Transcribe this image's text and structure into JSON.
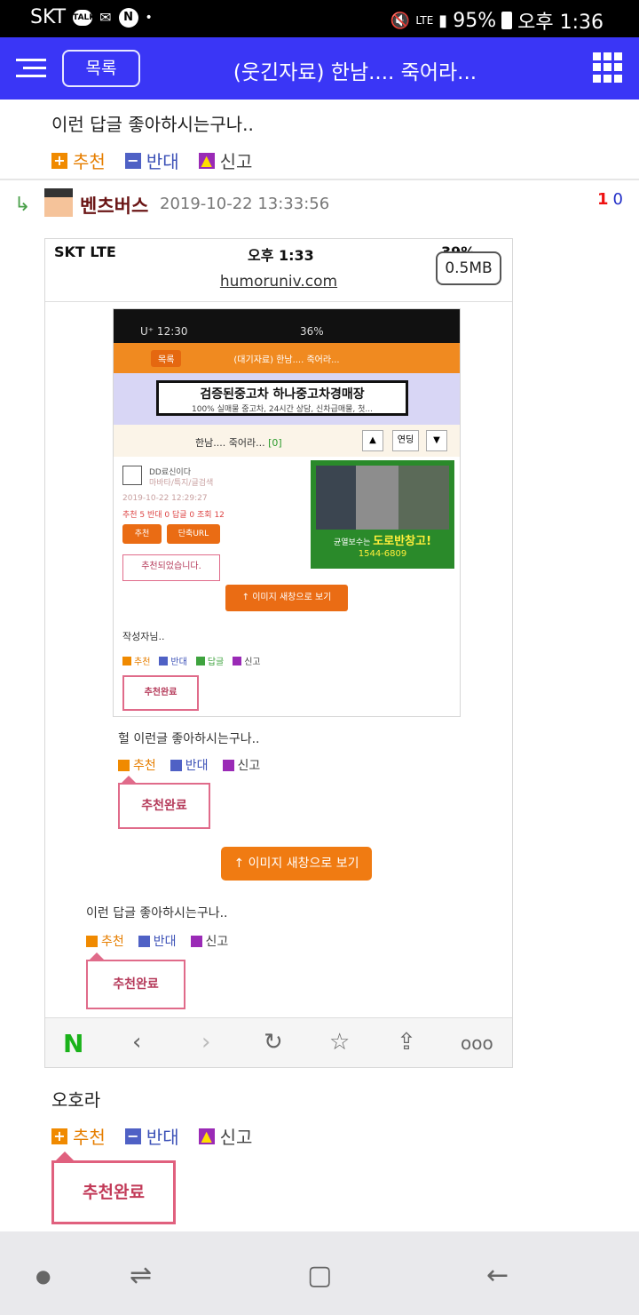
{
  "status_bar": {
    "carrier": "SKT",
    "talk_badge": "TALK",
    "n_badge": "N",
    "dot": "•",
    "lte": "LTE",
    "battery": "95%",
    "time": "오후 1:36"
  },
  "app_bar": {
    "list_button": "목록",
    "title": "(웃긴자료) 한남.... 죽어라..."
  },
  "comment_top": {
    "text": "이런 답글 좋아하시는구나..",
    "recommend": "추천",
    "oppose": "반대",
    "report": "신고"
  },
  "reply": {
    "username": "벤츠버스",
    "timestamp": "2019-10-22 13:33:56",
    "up_count": "1",
    "down_count": "0"
  },
  "screenshot": {
    "status_left": "SKT LTE",
    "status_time": "오후 1:33",
    "status_right": "39%",
    "file_size": "0.5MB",
    "url": "humoruniv.com",
    "inner": {
      "status": "U⁺ 12:30",
      "status_right": "36%",
      "list": "목록",
      "title": "(대기자료) 한남.... 죽어라...",
      "ad_title": "검증된중고차 하나중고차경매장",
      "ad_sub": "100% 실매물 중고차, 24시간 상담, 신차급매물, 첫...",
      "post_title": "한남.... 죽어라...",
      "post_count": "[0]",
      "nav_up": "▲",
      "nav_mid": "연딩",
      "nav_down": "▼",
      "author": "DD료신이다",
      "author_sub": "마바타/특지/글검색",
      "date": "2019-10-22 12:29:27",
      "stats": "추천 5 반대 0 답글 0 조회 12",
      "btn_recommend": "추천",
      "btn_url": "단축URL",
      "recommended_msg": "추천되었습니다.",
      "photo_caption": "균열보수는",
      "photo_brand": "도로반창고!",
      "photo_phone": "1544-6809",
      "view_image": "↑ 이미지 새창으로 보기",
      "comment": "작성자님..",
      "vote_rec": "추천",
      "vote_opp": "반대",
      "vote_reply": "답글",
      "vote_rep": "신고",
      "done": "추천완료"
    },
    "mid_comment": "헐 이런글 좋아하시는구나..",
    "mid_rec": "추천",
    "mid_opp": "반대",
    "mid_rep": "신고",
    "mid_done": "추천완료",
    "view_image": "↑ 이미지 새창으로 보기",
    "low_comment": "이런 답글 좋아하시는구나..",
    "low_rec": "추천",
    "low_opp": "반대",
    "low_rep": "신고",
    "low_done": "추천완료",
    "toolbar_n": "N"
  },
  "reply_comment": {
    "text": "오호라",
    "recommend": "추천",
    "oppose": "반대",
    "report": "신고",
    "done": "추천완료"
  },
  "colors": {
    "app_bar": "#3a36f6",
    "recommend": "#e67e00",
    "oppose": "#3c51b7",
    "done_border": "#e0607e"
  }
}
